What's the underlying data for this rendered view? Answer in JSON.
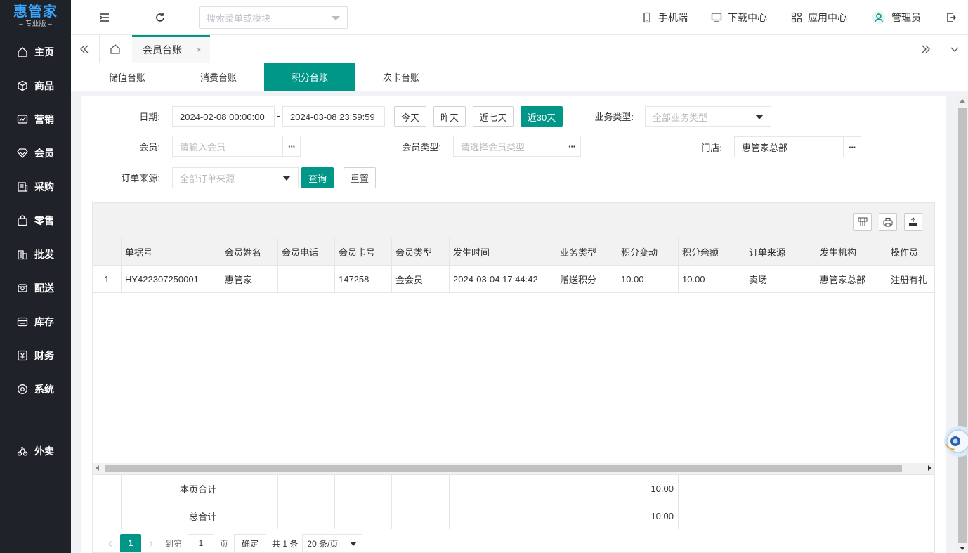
{
  "brand": {
    "name": "惠管家",
    "edition": "专业版"
  },
  "colors": {
    "accent": "#009688",
    "sidebar": "#1f2329",
    "logo": "#3aa6ff"
  },
  "sidebar": {
    "items": [
      {
        "label": "主页",
        "icon": "home-icon"
      },
      {
        "label": "商品",
        "icon": "box-icon"
      },
      {
        "label": "营销",
        "icon": "chart-icon"
      },
      {
        "label": "会员",
        "icon": "diamond-icon"
      },
      {
        "label": "采购",
        "icon": "purchase-icon"
      },
      {
        "label": "零售",
        "icon": "bag-icon"
      },
      {
        "label": "批发",
        "icon": "building-icon"
      },
      {
        "label": "配送",
        "icon": "delivery-icon"
      },
      {
        "label": "库存",
        "icon": "inventory-icon"
      },
      {
        "label": "财务",
        "icon": "yen-icon"
      },
      {
        "label": "系统",
        "icon": "settings-icon"
      },
      {
        "label": "外卖",
        "icon": "bike-icon"
      }
    ]
  },
  "header": {
    "search_placeholder": "搜索菜单或模块",
    "links": [
      {
        "label": "手机端",
        "icon": "phone-icon"
      },
      {
        "label": "下载中心",
        "icon": "monitor-icon"
      },
      {
        "label": "应用中心",
        "icon": "apps-icon"
      },
      {
        "label": "管理员",
        "icon": "user-icon"
      }
    ]
  },
  "tabs": {
    "current": "会员台账",
    "close": "×"
  },
  "subtabs": [
    "储值台账",
    "消费台账",
    "积分台账",
    "次卡台账"
  ],
  "subtab_active": "积分台账",
  "filters": {
    "date_label": "日期:",
    "date_start": "2024-02-08 00:00:00",
    "date_sep": "-",
    "date_end": "2024-03-08 23:59:59",
    "quick": [
      "今天",
      "昨天",
      "近七天",
      "近30天"
    ],
    "quick_active": "近30天",
    "biz_type_label": "业务类型:",
    "biz_type_placeholder": "全部业务类型",
    "member_label": "会员:",
    "member_placeholder": "请输入会员",
    "member_type_label": "会员类型:",
    "member_type_placeholder": "请选择会员类型",
    "store_label": "门店:",
    "store_value": "惠管家总部",
    "order_source_label": "订单来源:",
    "order_source_placeholder": "全部订单来源",
    "query_btn": "查询",
    "reset_btn": "重置",
    "more": "···"
  },
  "table": {
    "columns": [
      "",
      "单据号",
      "会员姓名",
      "会员电话",
      "会员卡号",
      "会员类型",
      "发生时间",
      "业务类型",
      "积分变动",
      "积分余额",
      "订单来源",
      "发生机构",
      "操作员"
    ],
    "rows": [
      [
        "1",
        "HY422307250001",
        "惠管家",
        "",
        "147258",
        "金会员",
        "2024-03-04 17:44:42",
        "赠送积分",
        "10.00",
        "10.00",
        "卖场",
        "惠管家总部",
        "注册有礼"
      ]
    ],
    "page_total_label": "本页合计",
    "page_total_points": "10.00",
    "grand_total_label": "总合计",
    "grand_total_points": "10.00"
  },
  "pager": {
    "current": "1",
    "goto_label": "到第",
    "goto_value": "1",
    "page_unit": "页",
    "confirm": "确定",
    "total": "共 1 条",
    "page_size": "20 条/页"
  }
}
